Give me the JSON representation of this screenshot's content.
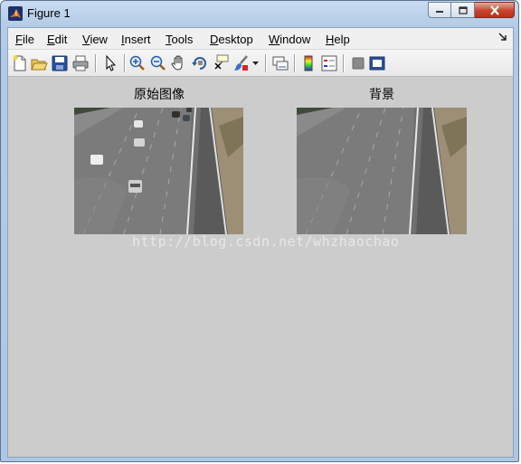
{
  "window": {
    "title": "Figure 1"
  },
  "menu": {
    "file": {
      "u": "F",
      "rest": "ile"
    },
    "edit": {
      "u": "E",
      "rest": "dit"
    },
    "view": {
      "u": "V",
      "rest": "iew"
    },
    "insert": {
      "u": "I",
      "rest": "nsert"
    },
    "tools": {
      "u": "T",
      "rest": "ools"
    },
    "desktop": {
      "u": "D",
      "rest": "esktop"
    },
    "window": {
      "u": "W",
      "rest": "indow"
    },
    "help": {
      "u": "H",
      "rest": "elp"
    }
  },
  "toolbar": {
    "icons": [
      "new-figure-icon",
      "open-file-icon",
      "save-icon",
      "print-icon",
      "pointer-icon",
      "zoom-in-icon",
      "zoom-out-icon",
      "pan-hand-icon",
      "rotate-3d-icon",
      "data-cursor-icon",
      "brush-icon",
      "link-plot-icon",
      "colorbar-icon",
      "legend-icon",
      "hide-plot-tools-icon",
      "show-plot-tools-icon"
    ]
  },
  "axes": [
    {
      "title": "原始图像",
      "content": "highway-frame-with-cars"
    },
    {
      "title": "背景",
      "content": "highway-background-no-cars"
    }
  ],
  "watermark": "http://blog.csdn.net/whzhaochao",
  "colors": {
    "figure_bg": "#cccccc",
    "title_accent": "#c7432b"
  }
}
